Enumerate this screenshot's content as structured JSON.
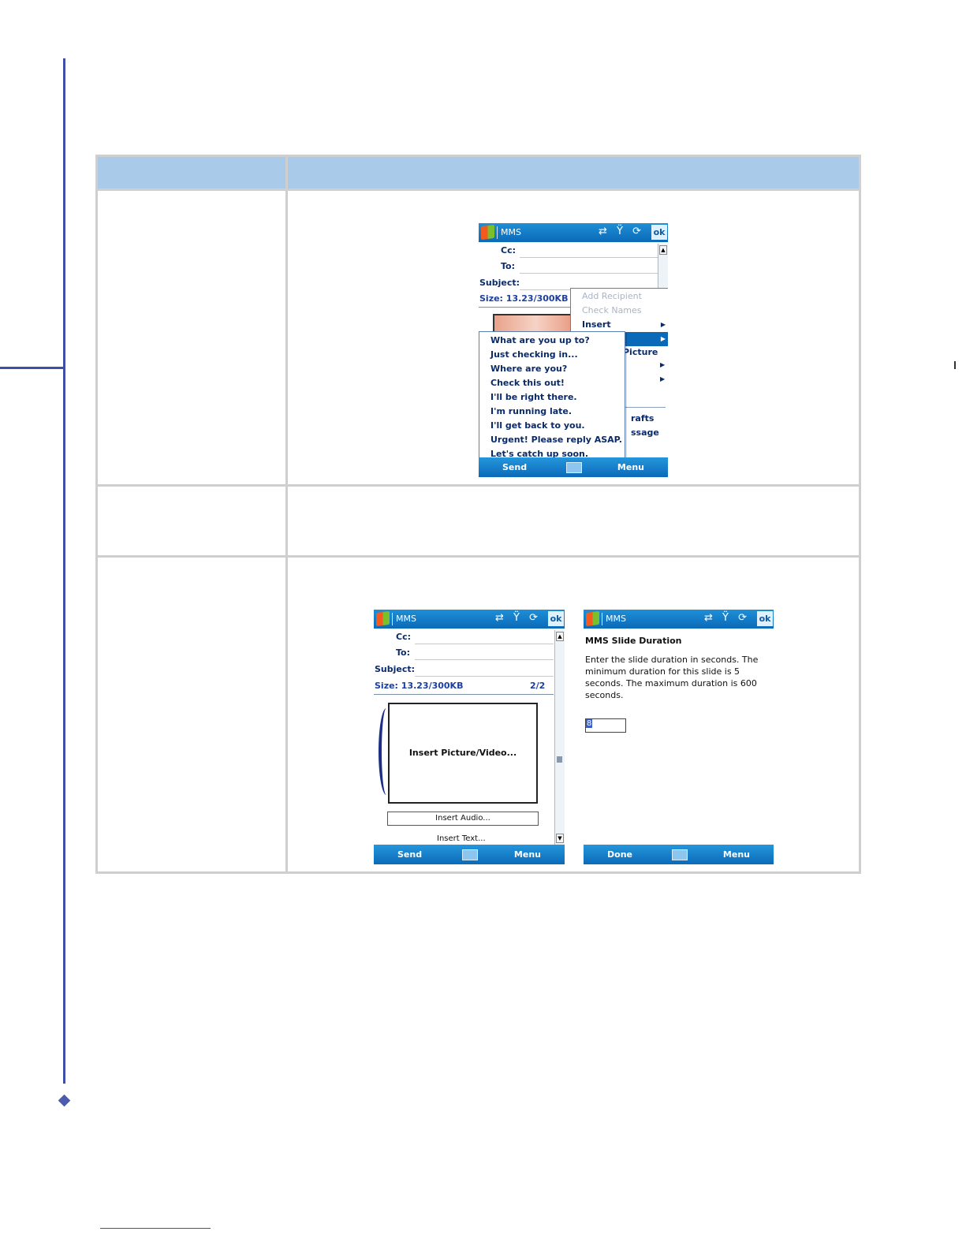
{
  "screen1": {
    "title": "MMS",
    "ok": "ok",
    "cc_label": "Cc:",
    "to_label": "To:",
    "subject_label": "Subject:",
    "size": "Size: 13.23/300KB",
    "context_menu": [
      {
        "label": "Add Recipient",
        "disabled": true
      },
      {
        "label": "Check Names",
        "disabled": true
      },
      {
        "label": "Insert",
        "disabled": false
      }
    ],
    "menu_peek": {
      "picture": "Picture",
      "drafts": "rafts",
      "message": "ssage"
    },
    "my_text_list": [
      "What are you up to?",
      "Just checking in...",
      "Where are you?",
      "Check this out!",
      "I'll be right there.",
      "I'm running late.",
      "I'll get back to you.",
      "Urgent! Please reply ASAP.",
      "Let's catch up soon."
    ],
    "bottom_left": "Send",
    "bottom_right": "Menu"
  },
  "screen2": {
    "title": "MMS",
    "ok": "ok",
    "cc_label": "Cc:",
    "to_label": "To:",
    "subject_label": "Subject:",
    "size": "Size: 13.23/300KB",
    "slide_counter": "2/2",
    "insert_picture": "Insert Picture/Video...",
    "insert_audio": "Insert Audio...",
    "insert_text": "Insert Text...",
    "bottom_left": "Send",
    "bottom_right": "Menu"
  },
  "screen3": {
    "title": "MMS",
    "ok": "ok",
    "dialog_title": "MMS Slide Duration",
    "dialog_text": "Enter the slide duration in seconds. The minimum duration for this slide is 5 seconds. The maximum duration is 600 seconds.",
    "duration_value": "8",
    "bottom_left": "Done",
    "bottom_right": "Menu"
  }
}
